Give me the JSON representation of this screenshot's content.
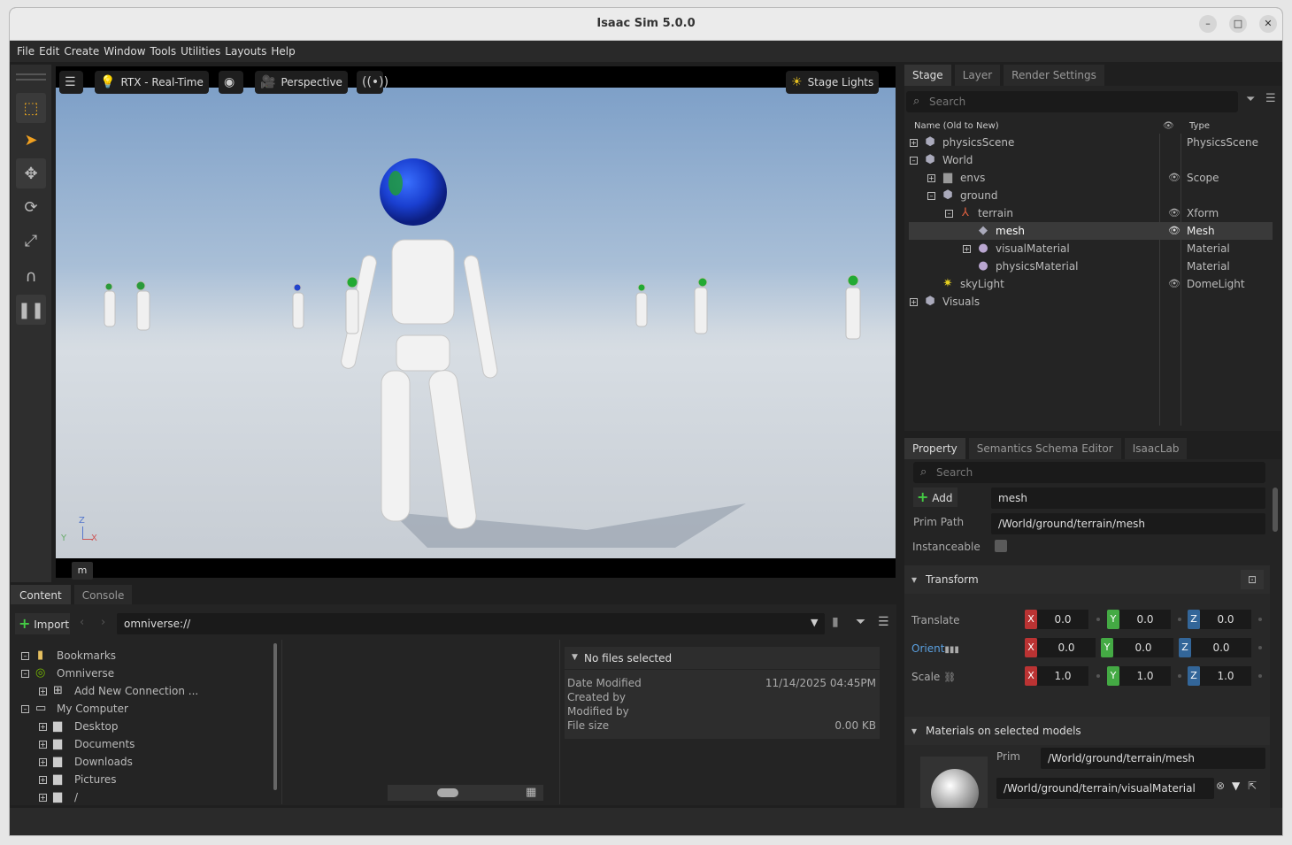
{
  "window": {
    "title": "Isaac Sim 5.0.0",
    "minimize": "–",
    "maximize": "□",
    "close": "✕"
  },
  "menu": [
    "File",
    "Edit",
    "Create",
    "Window",
    "Tools",
    "Utilities",
    "Layouts",
    "Help"
  ],
  "viewport": {
    "renderer": "RTX - Real-Time",
    "camera": "Perspective",
    "lights": "Stage Lights",
    "overlay_key": "m",
    "axes": {
      "z": "Z",
      "y": "Y",
      "x": "X"
    }
  },
  "stage": {
    "tabs": [
      "Stage",
      "Layer",
      "Render Settings"
    ],
    "search_placeholder": "Search",
    "col_name": "Name (Old to New)",
    "col_type": "Type",
    "rows": [
      {
        "name": "physicsScene",
        "type": "PhysicsScene",
        "icon": "cube-icon"
      },
      {
        "name": "World",
        "type": "",
        "icon": "cube-icon"
      },
      {
        "name": "envs",
        "type": "Scope",
        "icon": "folder-icon"
      },
      {
        "name": "ground",
        "type": "",
        "icon": "cube-icon"
      },
      {
        "name": "terrain",
        "type": "Xform",
        "icon": "xform-icon"
      },
      {
        "name": "mesh",
        "type": "Mesh",
        "icon": "mesh-icon"
      },
      {
        "name": "visualMaterial",
        "type": "Material",
        "icon": "material-icon"
      },
      {
        "name": "physicsMaterial",
        "type": "Material",
        "icon": "material-icon"
      },
      {
        "name": "skyLight",
        "type": "DomeLight",
        "icon": "light-icon"
      },
      {
        "name": "Visuals",
        "type": "",
        "icon": "cube-icon"
      }
    ]
  },
  "property": {
    "tabs": [
      "Property",
      "Semantics Schema Editor",
      "IsaacLab"
    ],
    "search_placeholder": "Search",
    "add_label": "Add",
    "name_value": "mesh",
    "prim_path_label": "Prim Path",
    "prim_path": "/World/ground/terrain/mesh",
    "instanceable_label": "Instanceable",
    "transform_label": "Transform",
    "translate_label": "Translate",
    "orient_label": "Orient",
    "scale_label": "Scale",
    "translate": [
      "0.0",
      "0.0",
      "0.0"
    ],
    "orient": [
      "0.0",
      "0.0",
      "0.0"
    ],
    "scale": [
      "1.0",
      "1.0",
      "1.0"
    ],
    "materials_label": "Materials on selected models",
    "prim_label": "Prim",
    "mat_prim": "/World/ground/terrain/mesh",
    "mat_path": "/World/ground/terrain/visualMaterial"
  },
  "content": {
    "tabs": [
      "Content",
      "Console"
    ],
    "import_label": "Import",
    "path": "omniverse://",
    "tree": [
      "Bookmarks",
      "Omniverse",
      "Add New Connection ...",
      "My Computer",
      "Desktop",
      "Documents",
      "Downloads",
      "Pictures",
      "/"
    ],
    "details": {
      "header": "No files selected",
      "date_label": "Date Modified",
      "date_value": "11/14/2025 04:45PM",
      "created_label": "Created by",
      "modified_label": "Modified by",
      "size_label": "File size",
      "size_value": "0.00 KB"
    }
  }
}
